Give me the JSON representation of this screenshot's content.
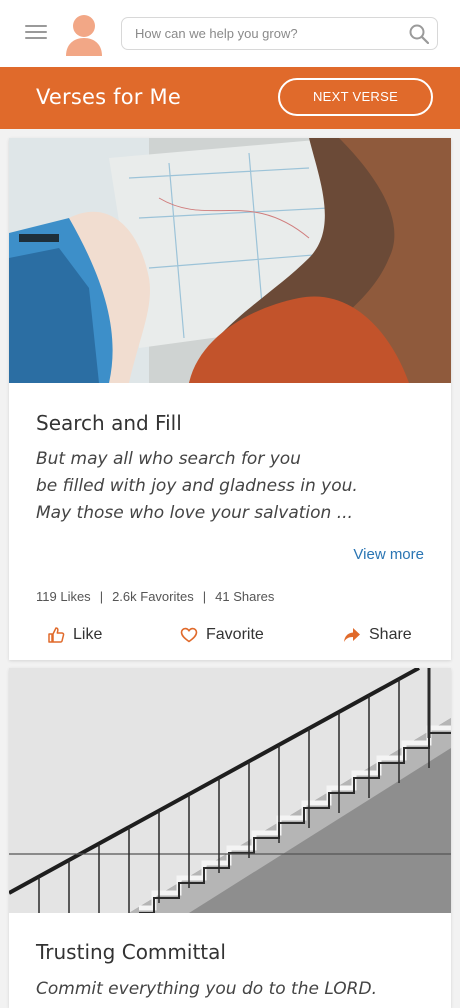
{
  "search": {
    "placeholder": "How can we help you grow?"
  },
  "header": {
    "title": "Verses for Me",
    "next_button": "NEXT VERSE"
  },
  "cards": [
    {
      "title": "Search and Fill",
      "lines": [
        "But may all who search for you",
        "be filled with joy and gladness in you.",
        "May those who love your salvation ..."
      ],
      "view_more": "View more",
      "likes": "119 Likes",
      "favorites": "2.6k Favorites",
      "shares": "41 Shares",
      "like_label": "Like",
      "favorite_label": "Favorite",
      "share_label": "Share"
    },
    {
      "title": "Trusting Committal",
      "lines": [
        "Commit everything you do to the LORD."
      ]
    }
  ],
  "colors": {
    "accent": "#e06a2b",
    "link": "#2a75b3"
  },
  "icons": [
    "menu-icon",
    "avatar-icon",
    "search-icon",
    "thumbs-up-icon",
    "heart-icon",
    "share-arrow-icon"
  ]
}
